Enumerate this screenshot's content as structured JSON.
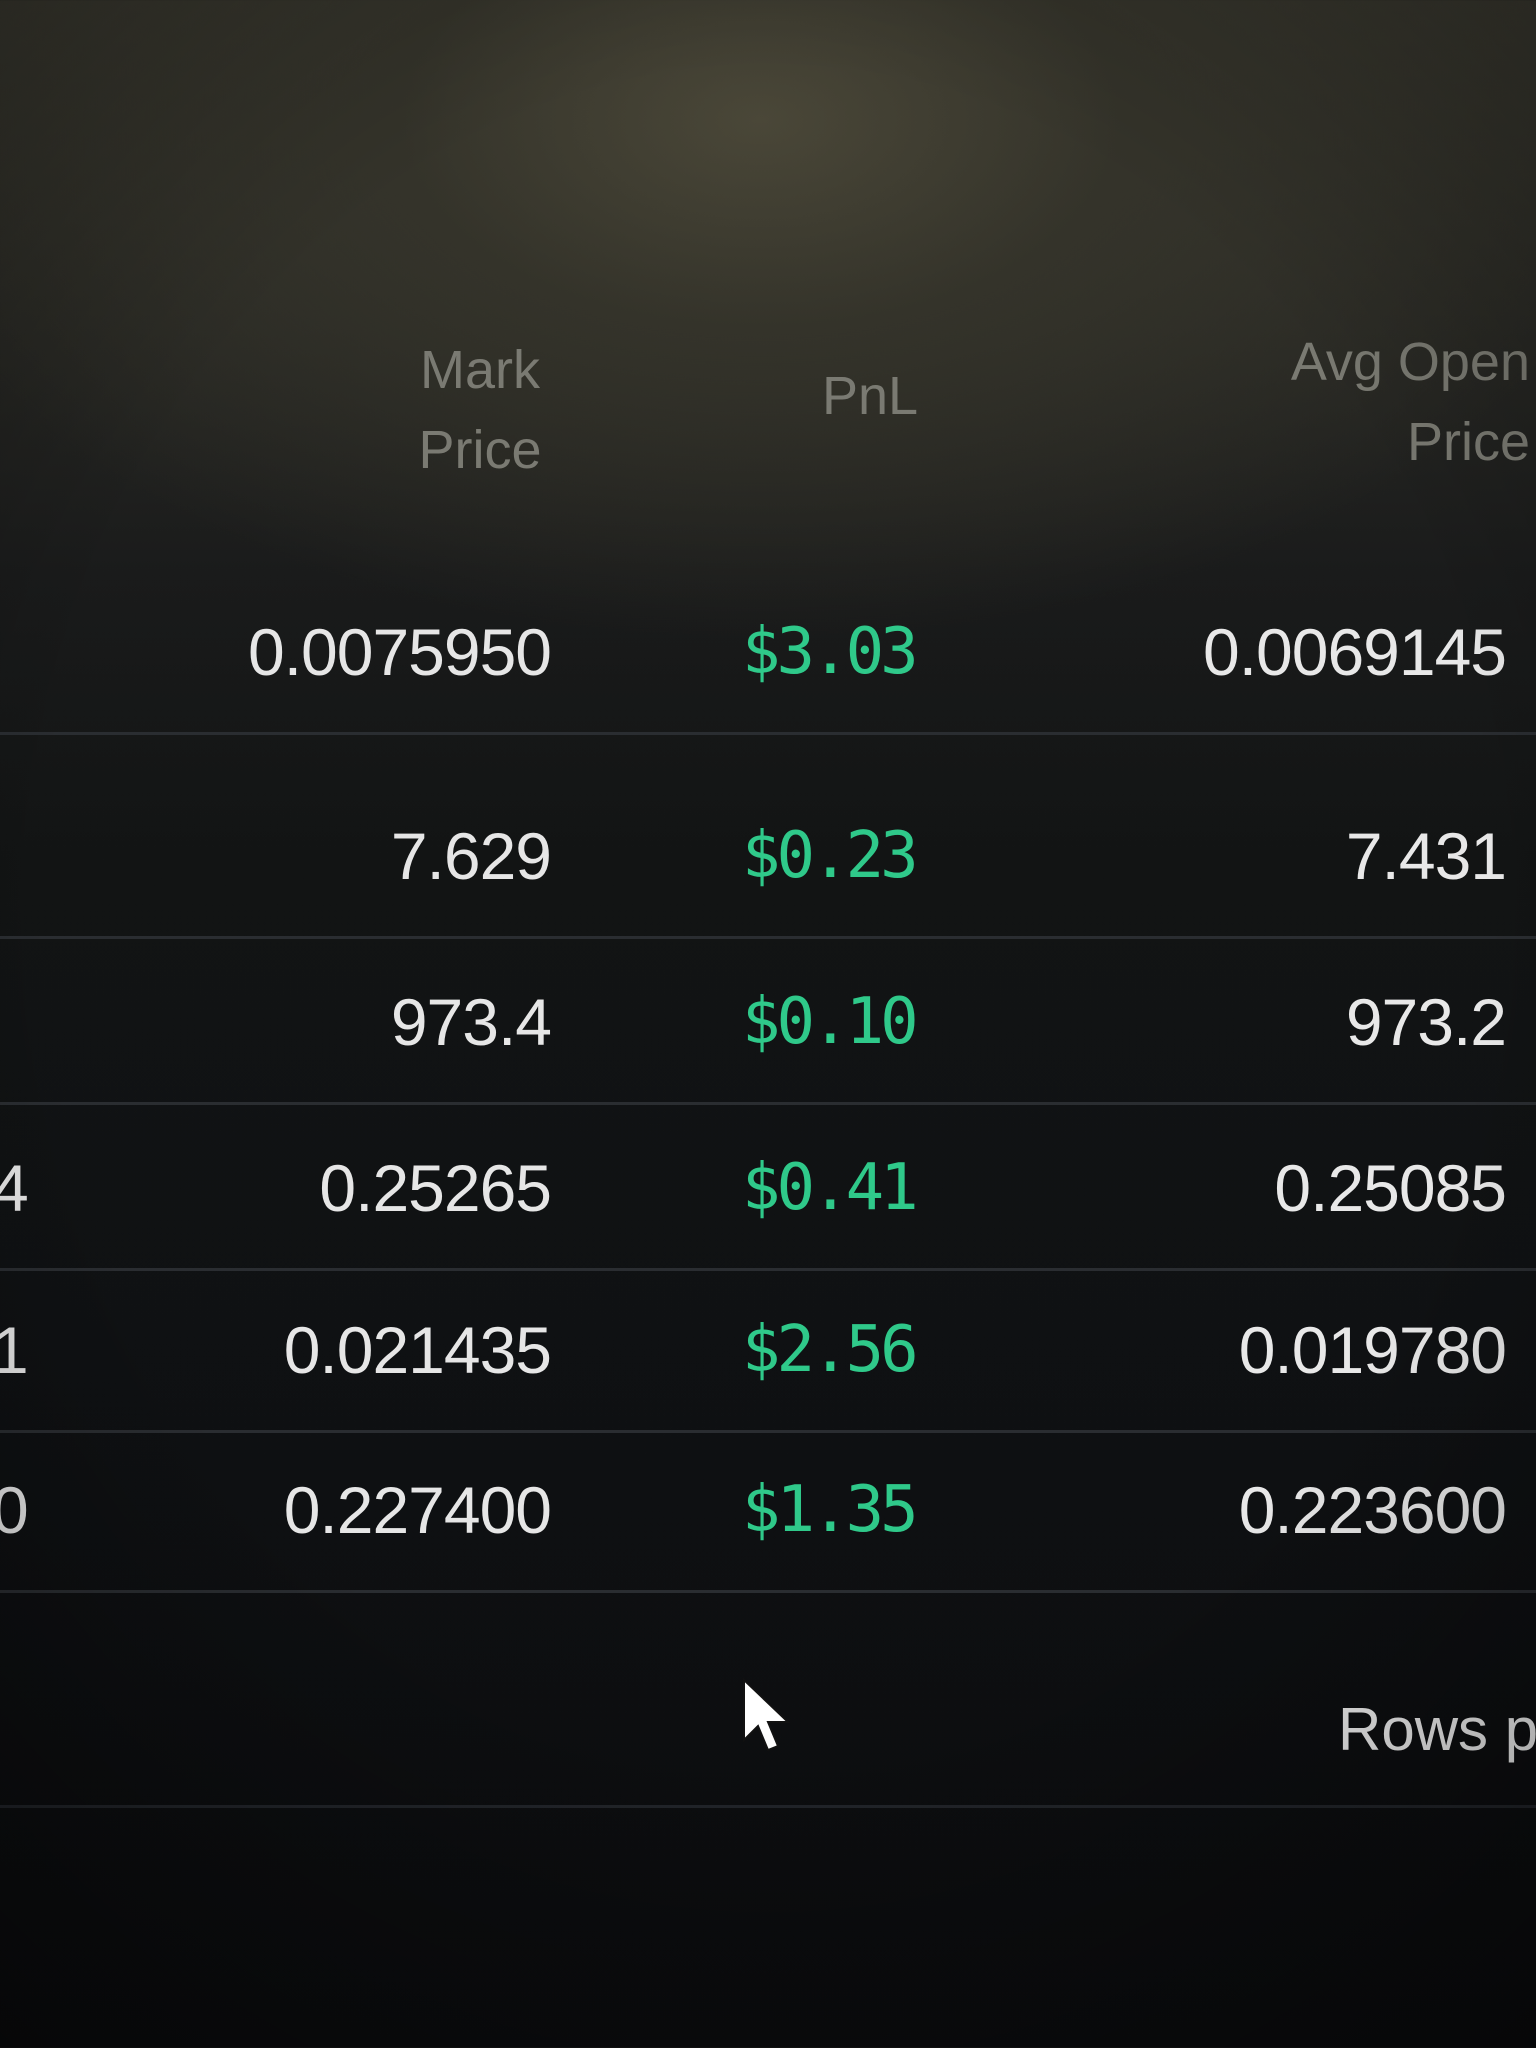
{
  "table": {
    "headers": {
      "mark_price": [
        "Mark",
        "Price"
      ],
      "pnl": "PnL",
      "avg_open_price": [
        "Avg Open",
        "Price"
      ]
    },
    "rows": [
      {
        "edge": "",
        "mark_price": "0.0075950",
        "pnl": "$3.03",
        "avg_open_price": "0.0069145"
      },
      {
        "edge": "",
        "mark_price": "7.629",
        "pnl": "$0.23",
        "avg_open_price": "7.431"
      },
      {
        "edge": "",
        "mark_price": "973.4",
        "pnl": "$0.10",
        "avg_open_price": "973.2"
      },
      {
        "edge": "4",
        "mark_price": "0.25265",
        "pnl": "$0.41",
        "avg_open_price": "0.25085"
      },
      {
        "edge": "1",
        "mark_price": "0.021435",
        "pnl": "$2.56",
        "avg_open_price": "0.019780"
      },
      {
        "edge": "0",
        "mark_price": "0.227400",
        "pnl": "$1.35",
        "avg_open_price": "0.223600"
      }
    ]
  },
  "footer": {
    "rows_per_page_label": "Rows p"
  },
  "colors": {
    "pnl_positive": "#2fc98a",
    "header_text": "#7a7a72",
    "value_text": "#e6e6e6"
  },
  "icons": {
    "cursor": "mouse-pointer-icon"
  }
}
